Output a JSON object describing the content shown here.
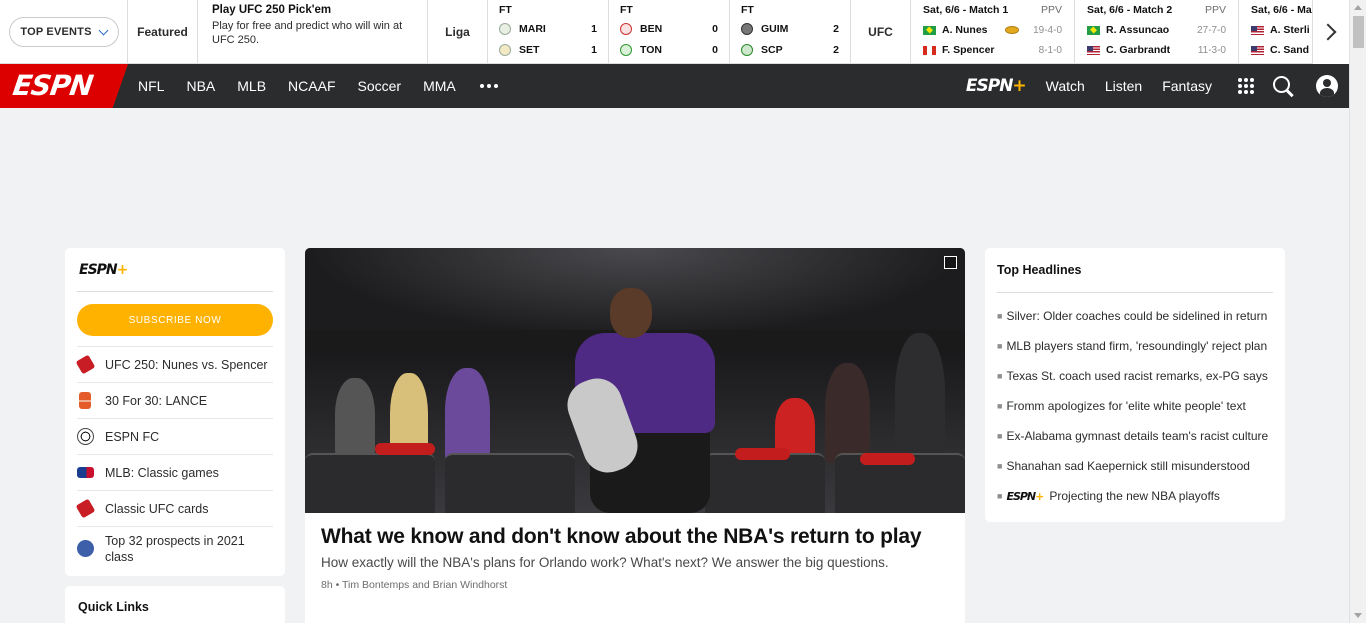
{
  "scorestrip": {
    "top_events": "TOP EVENTS",
    "featured": "Featured",
    "pickem": {
      "title": "Play UFC 250 Pick'em",
      "desc": "Play for free and predict who will win at UFC 250."
    },
    "liga": "Liga",
    "games": [
      {
        "status": "FT",
        "home": "MARI",
        "home_score": "1",
        "away": "SET",
        "away_score": "1"
      },
      {
        "status": "FT",
        "home": "BEN",
        "home_score": "0",
        "away": "TON",
        "away_score": "0"
      },
      {
        "status": "FT",
        "home": "GUIM",
        "home_score": "2",
        "away": "SCP",
        "away_score": "2"
      }
    ],
    "ufc": "UFC",
    "fights": [
      {
        "match": "Sat, 6/6 - Match 1",
        "ppv": "PPV",
        "f1": "A. Nunes",
        "f1_rec": "19-4-0",
        "f2": "F. Spencer",
        "f2_rec": "8-1-0"
      },
      {
        "match": "Sat, 6/6 - Match 2",
        "ppv": "PPV",
        "f1": "R. Assuncao",
        "f1_rec": "27-7-0",
        "f2": "C. Garbrandt",
        "f2_rec": "11-3-0"
      },
      {
        "match": "Sat, 6/6 - Ma",
        "ppv": "",
        "f1": "A. Sterli",
        "f1_rec": "",
        "f2": "C. Sand",
        "f2_rec": ""
      }
    ]
  },
  "nav": {
    "logo": "ESPN",
    "links": [
      "NFL",
      "NBA",
      "MLB",
      "NCAAF",
      "Soccer",
      "MMA"
    ],
    "espnplus": "ESPN",
    "right_links": [
      "Watch",
      "Listen",
      "Fantasy"
    ]
  },
  "sidebar": {
    "logo": "ESPN",
    "subscribe": "SUBSCRIBE NOW",
    "items": [
      {
        "label": "UFC 250: Nunes vs. Spencer",
        "icon": "glove-icon"
      },
      {
        "label": "30 For 30: LANCE",
        "icon": "30for30-icon"
      },
      {
        "label": "ESPN FC",
        "icon": "soccer-ball-icon"
      },
      {
        "label": "MLB: Classic games",
        "icon": "mlb-icon"
      },
      {
        "label": "Classic UFC cards",
        "icon": "glove-icon"
      },
      {
        "label": "Top 32 prospects in 2021 class",
        "icon": "draft-icon"
      }
    ],
    "quick_links": "Quick Links"
  },
  "hero": {
    "title": "What we know and don't know about the NBA's return to play",
    "desc": "How exactly will the NBA's plans for Orlando work? What's next? We answer the big questions.",
    "meta": "8h • Tim Bontemps and Brian Windhorst"
  },
  "headlines": {
    "title": "Top Headlines",
    "items": [
      "Silver: Older coaches could be sidelined in return",
      "MLB players stand firm, 'resoundingly' reject plan",
      "Texas St. coach used racist remarks, ex-PG says",
      "Fromm apologizes for 'elite white people' text",
      "Ex-Alabama gymnast details team's racist culture",
      "Shanahan sad Kaepernick still misunderstood"
    ],
    "plus_item": "Projecting the new NBA playoffs"
  }
}
